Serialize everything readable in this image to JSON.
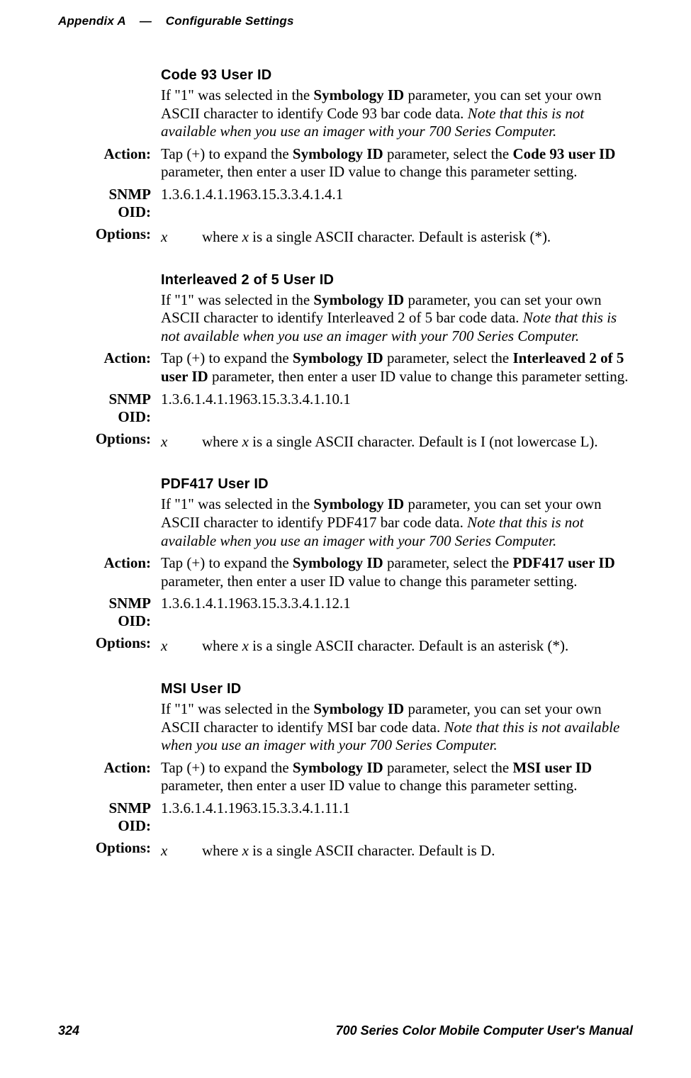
{
  "header": {
    "appendix": "Appendix  A",
    "dash": "—",
    "title": "Configurable Settings"
  },
  "sections": [
    {
      "title": "Code 93 User ID",
      "desc_pre": "If \"1\" was selected in the ",
      "desc_b1": "Symbology ID",
      "desc_mid": " parameter, you can set your own ASCII character to identify Code 93 bar code data. ",
      "desc_i": "Note that this is not available when you use an imager with your 700 Series Computer.",
      "action_pre": "Tap (+) to expand the ",
      "action_b1": "Symbology ID",
      "action_mid": " parameter, select the ",
      "action_b2": "Code 93 user ID",
      "action_post": " parameter, then enter a user ID value to change this parameter setting.",
      "snmp": "1.3.6.1.4.1.1963.15.3.3.4.1.4.1",
      "opt_x": "x",
      "opt_desc_pre": "where ",
      "opt_desc_i": "x",
      "opt_desc_post": " is a single ASCII character. Default is asterisk (*)."
    },
    {
      "title": "Interleaved 2 of 5 User ID",
      "desc_pre": "If \"1\" was selected in the ",
      "desc_b1": "Symbology ID",
      "desc_mid": " parameter, you can set your own ASCII character to identify Interleaved 2 of 5 bar code data. ",
      "desc_i": "Note that this is not available when you use an imager with your 700 Series Computer.",
      "action_pre": "Tap (+) to expand the ",
      "action_b1": "Symbology ID",
      "action_mid": " parameter, select the ",
      "action_b2": "Interleaved 2 of 5 user ID",
      "action_post": " parameter, then enter a user ID value to change this parameter setting.",
      "snmp": "1.3.6.1.4.1.1963.15.3.3.4.1.10.1",
      "opt_x": "x",
      "opt_desc_pre": "where ",
      "opt_desc_i": "x",
      "opt_desc_post": " is a single ASCII character. Default is I (not lowercase L)."
    },
    {
      "title": "PDF417 User ID",
      "desc_pre": "If \"1\" was selected in the ",
      "desc_b1": "Symbology ID",
      "desc_mid": " parameter, you can set your own ASCII character to identify PDF417 bar code data. ",
      "desc_i": "Note that this is not available when you use an imager with your 700 Series Computer.",
      "action_pre": "Tap (+) to expand the ",
      "action_b1": "Symbology ID",
      "action_mid": " parameter, select the ",
      "action_b2": "PDF417 user ID",
      "action_post": " parameter, then enter a user ID value to change this parameter setting.",
      "snmp": "1.3.6.1.4.1.1963.15.3.3.4.1.12.1",
      "opt_x": "x",
      "opt_desc_pre": "where ",
      "opt_desc_i": "x",
      "opt_desc_post": " is a single ASCII character. Default is an asterisk (*)."
    },
    {
      "title": "MSI User ID",
      "desc_pre": "If \"1\" was selected in the ",
      "desc_b1": "Symbology ID",
      "desc_mid": " parameter, you can set your own ASCII character to identify MSI bar code data. ",
      "desc_i": "Note that this is not available when you use an imager with your 700 Series Computer.",
      "action_pre": "Tap (+) to expand the ",
      "action_b1": "Symbology ID",
      "action_mid": " parameter, select the ",
      "action_b2": "MSI user ID",
      "action_post": " parameter, then enter a user ID value to change this parameter setting.",
      "snmp": "1.3.6.1.4.1.1963.15.3.3.4.1.11.1",
      "opt_x": "x",
      "opt_desc_pre": "where ",
      "opt_desc_i": "x",
      "opt_desc_post": " is a single ASCII character. Default is D."
    }
  ],
  "labels": {
    "action": "Action:",
    "snmp": "SNMP OID:",
    "options": "Options:"
  },
  "footer": {
    "page": "324",
    "title": "700 Series Color Mobile Computer User's Manual"
  }
}
